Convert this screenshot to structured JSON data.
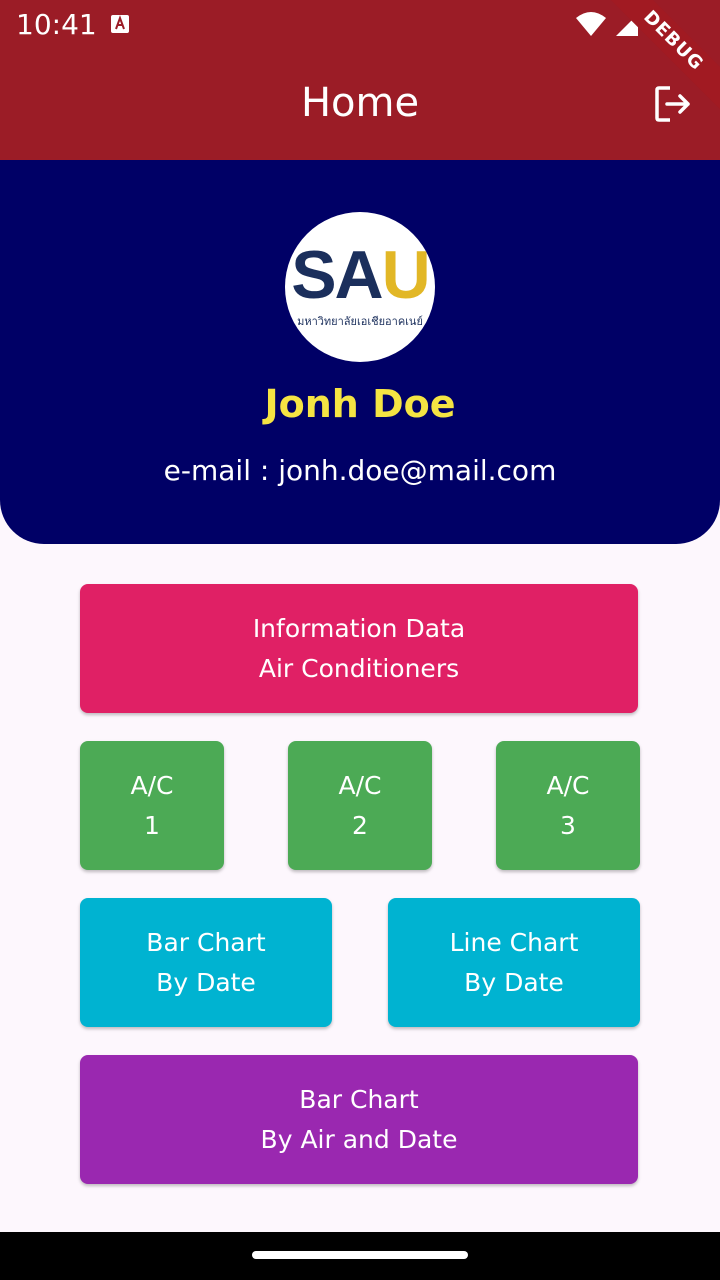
{
  "status_bar": {
    "time": "10:41",
    "icons": [
      "app-notification-icon",
      "wifi-icon",
      "cellular-signal-icon",
      "battery-icon"
    ]
  },
  "app_bar": {
    "title": "Home",
    "debug_banner": "DEBUG",
    "logout_icon": "logout-icon"
  },
  "profile": {
    "logo": {
      "main": "SA",
      "accent": "U",
      "subtitle": "มหาวิทยาลัยเอเชียอาคเนย์"
    },
    "name": "Jonh Doe",
    "email": "e-mail : jonh.doe@mail.com"
  },
  "menu": {
    "info": {
      "line1": "Information Data",
      "line2": "Air Conditioners"
    },
    "ac_units": [
      {
        "line1": "A/C",
        "line2": "1"
      },
      {
        "line1": "A/C",
        "line2": "2"
      },
      {
        "line1": "A/C",
        "line2": "3"
      }
    ],
    "bar_chart_date": {
      "line1": "Bar Chart",
      "line2": "By Date"
    },
    "line_chart_date": {
      "line1": "Line Chart",
      "line2": "By Date"
    },
    "bar_chart_air_date": {
      "line1": "Bar Chart",
      "line2": "By Air and Date"
    }
  },
  "colors": {
    "app_bar": "#9b1c26",
    "header": "#000066",
    "name": "#f5e443",
    "info_button": "#e02065",
    "ac_button": "#4caa55",
    "chart_button": "#00b3d1",
    "air_date_button": "#9a28b0"
  }
}
